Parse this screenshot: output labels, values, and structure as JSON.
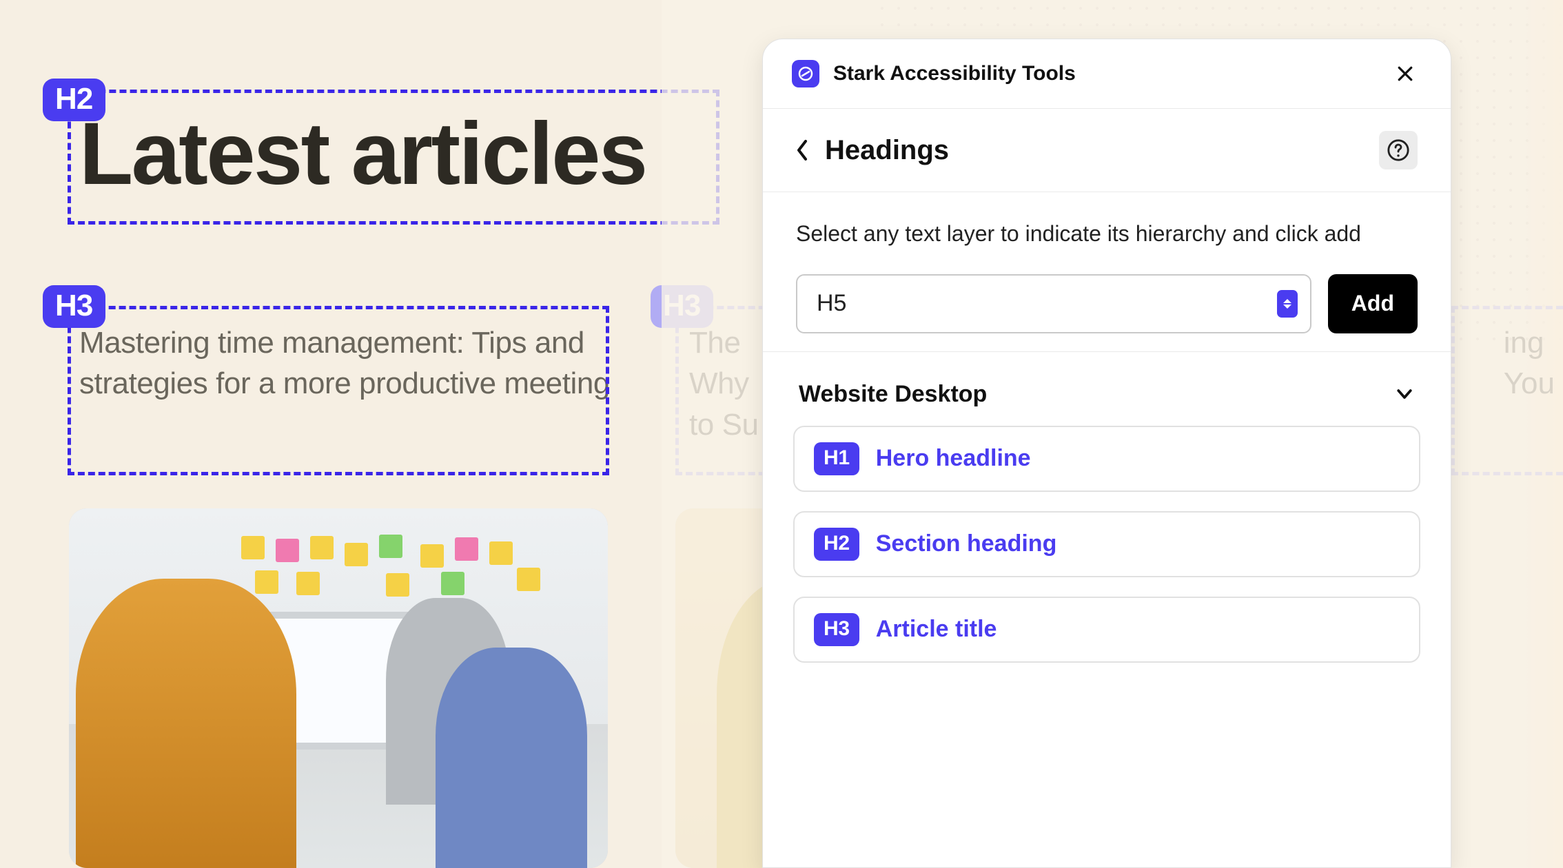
{
  "canvas": {
    "headline": "Latest articles",
    "headline_tag": "H2",
    "article_left": {
      "tag": "H3",
      "title": "Mastering time management: Tips and strategies for a more productive meeting"
    },
    "article_right": {
      "tag": "H3",
      "title_line1": "The ",
      "title_line2": "Why ",
      "title_line3": "to Su"
    },
    "right_edge_line1": "ing",
    "right_edge_line2": "You"
  },
  "panel": {
    "app_title": "Stark Accessibility Tools",
    "section_title": "Headings",
    "instruction": "Select any text layer to indicate its hierarchy and click add",
    "select_value": "H5",
    "add_label": "Add",
    "group_title": "Website Desktop",
    "items": [
      {
        "level": "H1",
        "label": "Hero headline"
      },
      {
        "level": "H2",
        "label": "Section heading"
      },
      {
        "level": "H3",
        "label": "Article title"
      }
    ]
  }
}
